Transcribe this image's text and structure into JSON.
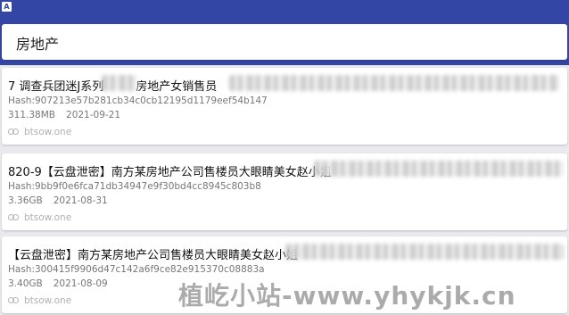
{
  "statusbar": {
    "icon_letter": "A"
  },
  "search": {
    "query": "房地产"
  },
  "results": [
    {
      "title": "7 调查兵团迷J系列",
      "title_tail": "房地产女销售员",
      "hash": "Hash:907213e57b281cb34c0cb12195d1179eef54b147",
      "size": "311.38MB",
      "date": "2021-09-21",
      "source": "btsow.one"
    },
    {
      "title": "820-9【云盘泄密】南方某房地产公司售楼员大眼睛美女赵小姐",
      "title_tail": "",
      "hash": "Hash:9bb9f0e6fca71db34947e9f30bd4cc8945c803b8",
      "size": "3.36GB",
      "date": "2021-08-31",
      "source": "btsow.one"
    },
    {
      "title": "【云盘泄密】南方某房地产公司售楼员大眼睛美女赵小姐",
      "title_tail": "",
      "hash": "Hash:300415f9906d47c142a6f9ce82e915370c08883a",
      "size": "3.40GB",
      "date": "2021-08-09",
      "source": "btsow.one"
    }
  ],
  "watermark": "植屹小站-www.yhykjk.cn",
  "colors": {
    "header": "#3346a6",
    "background": "#e9e9ee",
    "card": "#ffffff"
  }
}
